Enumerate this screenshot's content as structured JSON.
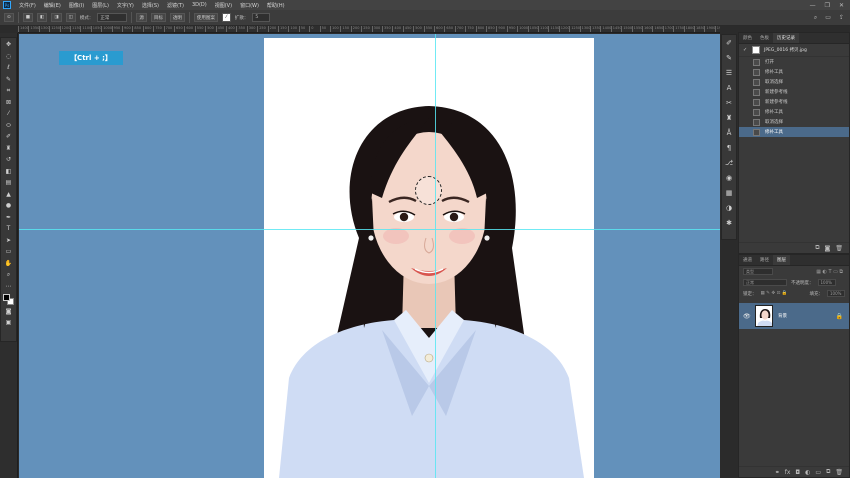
{
  "app": {
    "logo": "Ps"
  },
  "menu": [
    "文件(F)",
    "编辑(E)",
    "图像(I)",
    "图层(L)",
    "文字(Y)",
    "选择(S)",
    "滤镜(T)",
    "3D(D)",
    "视图(V)",
    "窗口(W)",
    "帮助(H)"
  ],
  "window_controls": [
    "—",
    "❐",
    "✕"
  ],
  "options": {
    "feather_label": "羽化：",
    "feather_value": "0 像素",
    "antialias_label": "消除锯齿",
    "style_label": "样式：",
    "style_value": "正常",
    "width_label": "宽度：",
    "height_label": "高度：",
    "select_mask_label": "选择并遮住...",
    "mode_label": "模式：",
    "mode_value": "正常",
    "source_label": "源",
    "dest_label": "目标",
    "transparent_label": "透明",
    "use_pattern_label": "使用图案",
    "spread_label": "扩散：",
    "spread_value": "5"
  },
  "shortcut_badge": "【Ctrl + ;】",
  "ruler_ticks": [
    "1400",
    "1350",
    "1300",
    "1250",
    "1200",
    "1150",
    "1100",
    "1050",
    "1000",
    "950",
    "900",
    "850",
    "800",
    "750",
    "700",
    "650",
    "600",
    "550",
    "500",
    "450",
    "400",
    "350",
    "300",
    "250",
    "200",
    "150",
    "100",
    "50",
    "0",
    "50",
    "100",
    "150",
    "200",
    "250",
    "300",
    "350",
    "400",
    "450",
    "500",
    "550",
    "600",
    "650",
    "700",
    "750",
    "800",
    "850",
    "900",
    "950",
    "1000",
    "1050",
    "1100",
    "1150",
    "1200",
    "1250",
    "1300",
    "1350",
    "1400",
    "1450",
    "1500",
    "1550",
    "1600",
    "1650",
    "1700",
    "1750",
    "1800",
    "1850",
    "1900",
    "1950"
  ],
  "history_panel": {
    "tabs": [
      "颜色",
      "色板",
      "历史记录"
    ],
    "active_tab": "历史记录",
    "snapshot_label": "JPEG_0016 拷贝.jpg",
    "rows": [
      "打开",
      "修补工具",
      "取消选择",
      "新建参考线",
      "新建参考线",
      "修补工具",
      "取消选择",
      "修补工具"
    ],
    "active_row": 7
  },
  "layers_panel": {
    "tabs": [
      "通道",
      "路径",
      "图层"
    ],
    "active_tab": "图层",
    "kind_label": "类型",
    "blend_mode": "正常",
    "opacity_label": "不透明度：",
    "opacity_value": "100%",
    "lock_label": "锁定：",
    "fill_label": "填充：",
    "fill_value": "100%",
    "layer_name": "背景"
  },
  "colors": {
    "canvas_bg": "#6391bb",
    "guide": "#58e6f2",
    "badge": "#2a9bd0",
    "selected_row": "#4b6a8a"
  }
}
